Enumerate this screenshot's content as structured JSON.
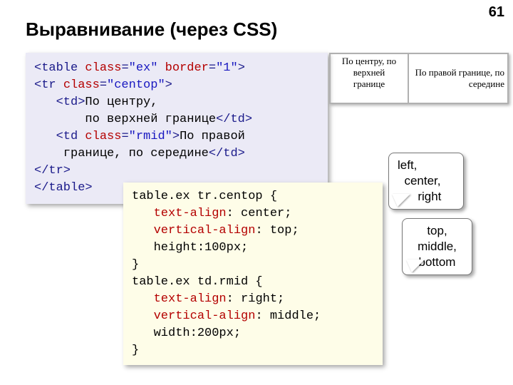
{
  "pageNumber": "61",
  "title": "Выравнивание (через CSS)",
  "htmlCode": {
    "l1_tag_open": "<table ",
    "l1_attr1": "class",
    "l1_eq1": "=",
    "l1_val1": "\"ex\"",
    "l1_sp": " ",
    "l1_attr2": "border",
    "l1_eq2": "=",
    "l1_val2": "\"1\"",
    "l1_tag_close": ">",
    "l2_tag_open": "<tr ",
    "l2_attr": "class",
    "l2_eq": "=",
    "l2_val": "\"centop\"",
    "l2_tag_close": ">",
    "l3_indent": "   ",
    "l3_td_open": "<td>",
    "l3_text": "По центру,",
    "l4_indent": "       ",
    "l4_text": "по верхней границе",
    "l4_td_close": "</td>",
    "l5_indent": "   ",
    "l5_td_open": "<td ",
    "l5_attr": "class",
    "l5_eq": "=",
    "l5_val": "\"rmid\"",
    "l5_td_close_gt": ">",
    "l5_text": "По правой",
    "l6_indent": "    ",
    "l6_text": "границе, по середине",
    "l6_td_close": "</td>",
    "l7_tr_close": "</tr>",
    "l8_table_close": "</table>"
  },
  "cssCode": {
    "l1_sel": "table.ex tr.centop {",
    "l2_ind": "   ",
    "l2_prop": "text-align",
    "l2_rest": ": center;",
    "l3_ind": "   ",
    "l3_prop": "vertical-align",
    "l3_rest": ": top;",
    "l4_ind": "   ",
    "l4_rest": "height:100px;",
    "l5": "}",
    "l6_sel": "table.ex td.rmid {",
    "l7_ind": "   ",
    "l7_prop": "text-align",
    "l7_rest": ": right;",
    "l8_ind": "   ",
    "l8_prop": "vertical-align",
    "l8_rest": ": middle;",
    "l9_ind": "   ",
    "l9_rest": "width:200px;",
    "l10": "}"
  },
  "demo": {
    "cell1_line1": "По центру, по",
    "cell1_line2": "верхней",
    "cell1_line3": "границе",
    "cell2_line1": "По правой границе, по",
    "cell2_line2": "середине"
  },
  "callout1": {
    "l1": "left,",
    "l2": "  center,",
    "l3": "      right"
  },
  "callout2": {
    "l1": "top,",
    "l2": "middle,",
    "l3": "bottom"
  }
}
